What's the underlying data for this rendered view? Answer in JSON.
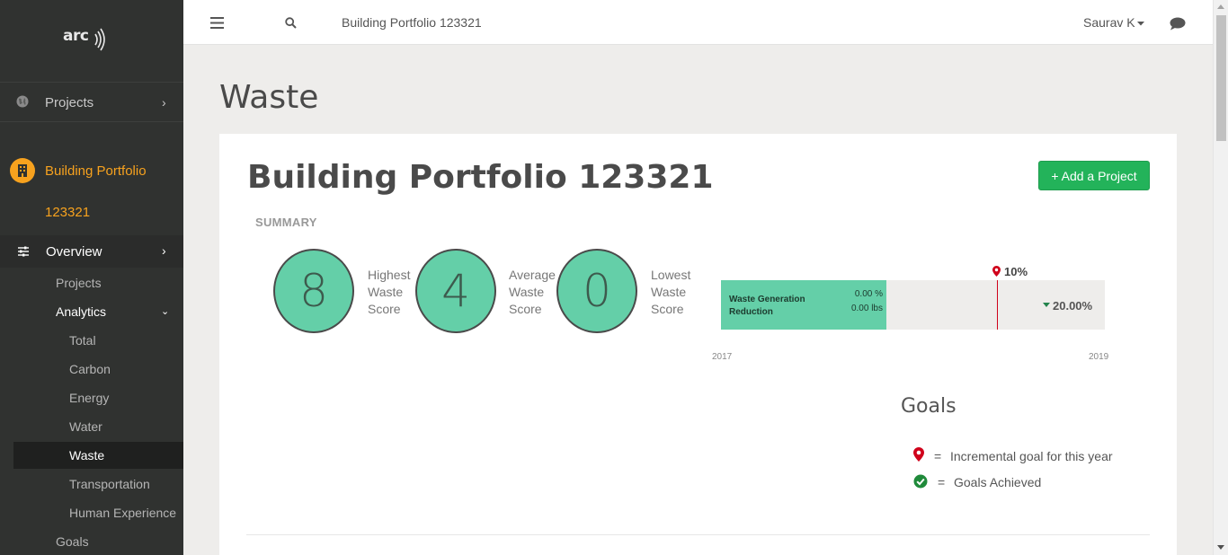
{
  "sidebar": {
    "logo_text": "arc",
    "projects_label": "Projects",
    "portfolio_line1": "Building Portfolio",
    "portfolio_line2": "123321",
    "overview_label": "Overview",
    "items": [
      {
        "label": "Projects"
      },
      {
        "label": "Analytics"
      },
      {
        "label": "Total"
      },
      {
        "label": "Carbon"
      },
      {
        "label": "Energy"
      },
      {
        "label": "Water"
      },
      {
        "label": "Waste"
      },
      {
        "label": "Transportation"
      },
      {
        "label": "Human Experience"
      },
      {
        "label": "Goals"
      }
    ]
  },
  "topbar": {
    "title": "Building Portfolio 123321",
    "user": "Saurav K"
  },
  "page": {
    "heading": "Waste",
    "card_title": "Building Portfolio 123321",
    "add_button": "+ Add a Project",
    "summary_label": "SUMMARY"
  },
  "scores": [
    {
      "value": "8",
      "label": "Highest Waste Score"
    },
    {
      "value": "4",
      "label": "Average Waste Score"
    },
    {
      "value": "0",
      "label": "Lowest Waste Score"
    }
  ],
  "progress": {
    "label_line1": "Waste Generation",
    "label_line2": "Reduction",
    "percent_value": "0.00 %",
    "lbs_value": "0.00 lbs",
    "goal_marker": "10%",
    "target": "20.00%",
    "start_year": "2017",
    "end_year": "2019",
    "fill_fraction": 0.43,
    "goal_fraction": 0.72
  },
  "goals": {
    "title": "Goals",
    "incremental_label": "Incremental goal for this year",
    "achieved_label": "Goals Achieved",
    "equals": "="
  },
  "colors": {
    "accent_green": "#64cfa8",
    "button_green": "#23b35a",
    "sidebar_active": "#f7a21e",
    "goal_red": "#d0021b"
  }
}
